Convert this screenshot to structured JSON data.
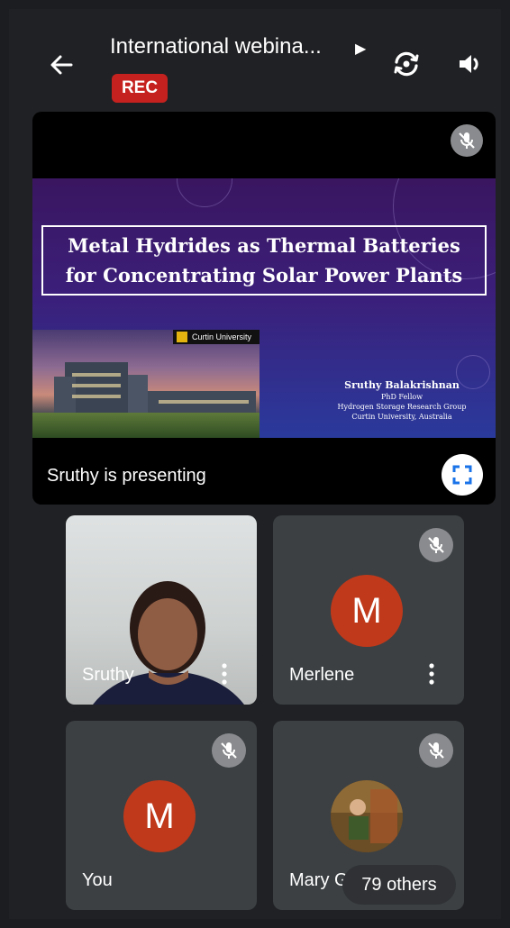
{
  "header": {
    "title": "International webina...",
    "rec_badge": "REC"
  },
  "presentation": {
    "slide_title": "Metal Hydrides as Thermal Batteries for Concentrating Solar Power Plants",
    "institution_badge": "Curtin University",
    "author_name": "Sruthy Balakrishnan",
    "author_lines": [
      "PhD Fellow",
      "Hydrogen Storage Research Group",
      "Curtin University, Australia"
    ],
    "status": "Sruthy is presenting"
  },
  "participants": [
    {
      "name": "Sruthy",
      "type": "video",
      "muted": false
    },
    {
      "name": "Merlene",
      "initial": "M",
      "muted": true
    },
    {
      "name": "You",
      "initial": "M",
      "muted": true
    },
    {
      "name": "Mary G",
      "type": "photo",
      "muted": true
    }
  ],
  "others_chip": "79 others",
  "colors": {
    "background": "#202124",
    "tile": "#3c4043",
    "rec": "#c5221f",
    "avatar": "#c0391b",
    "accent": "#1a73e8"
  },
  "icons": {
    "back": "arrow-left",
    "flip_camera": "camera-flip",
    "speaker": "volume",
    "mic_off": "mic-off",
    "fullscreen": "fullscreen",
    "more": "more-vertical"
  }
}
